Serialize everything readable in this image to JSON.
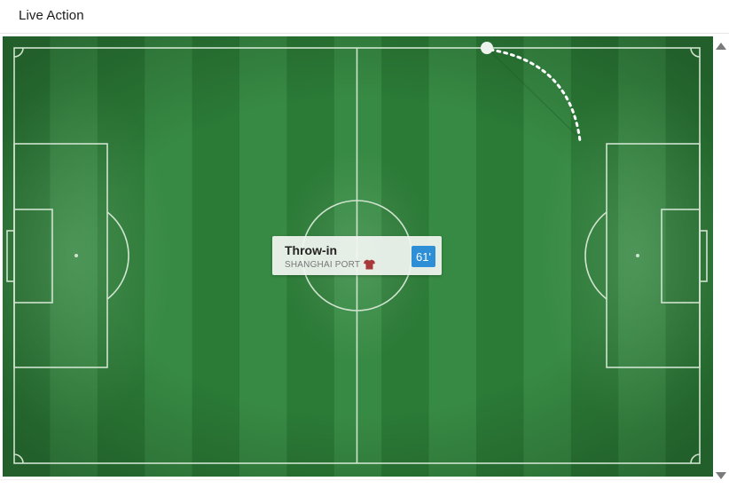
{
  "header": {
    "title": "Live Action"
  },
  "pitch": {
    "colors": {
      "stripe_dark": "#2b7a36",
      "stripe_light": "#378a43",
      "line": "#cfe3cf",
      "ball": "#eef3ee",
      "trajectory": "#ffffff"
    }
  },
  "event": {
    "type": "Throw-in",
    "team": "SHANGHAI PORT",
    "minute": "61'",
    "team_kit_color": "#a8393a",
    "badge_color": "#2e8fd6",
    "icon": "shirt-icon"
  },
  "scrollbar": {
    "up_icon": "scroll-up-arrow-icon",
    "down_icon": "scroll-down-arrow-icon"
  }
}
